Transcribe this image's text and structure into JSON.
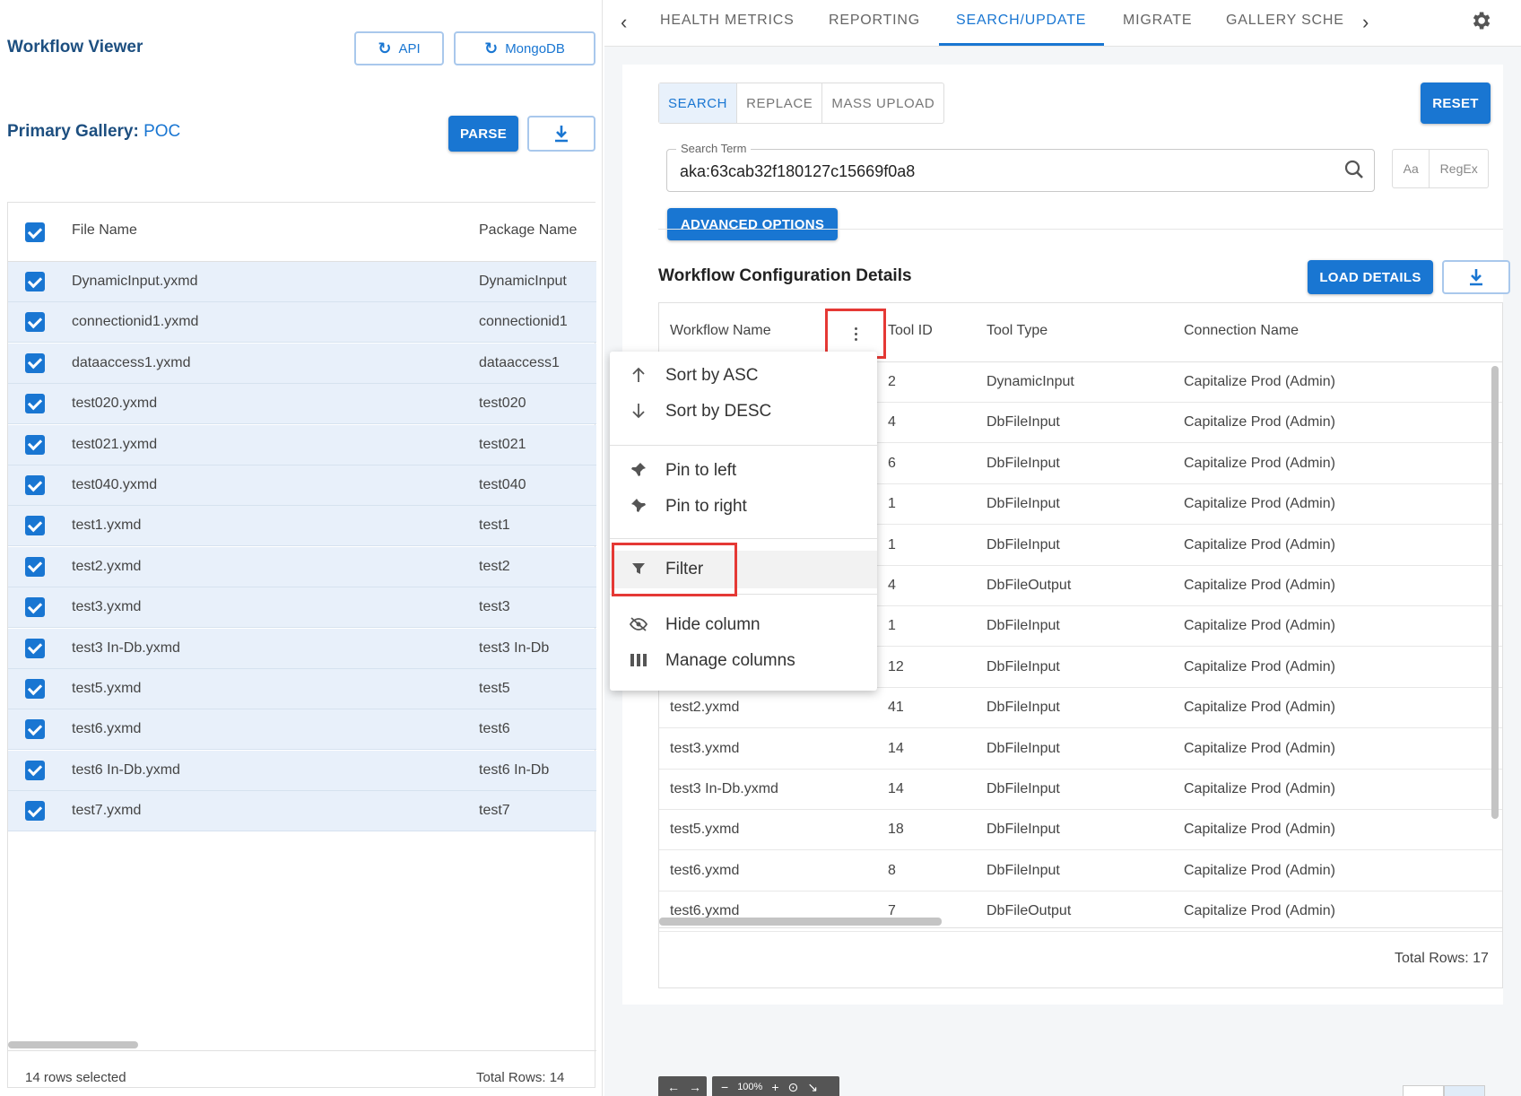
{
  "left": {
    "title": "Workflow Viewer",
    "api_label": "API",
    "mongodb_label": "MongoDB",
    "gallery_label": "Primary Gallery:",
    "gallery_value": "POC",
    "parse_label": "PARSE",
    "headers": {
      "file_name": "File Name",
      "package_name": "Package Name"
    },
    "rows": [
      {
        "file": "DynamicInput.yxmd",
        "pkg": "DynamicInput"
      },
      {
        "file": "connectionid1.yxmd",
        "pkg": "connectionid1"
      },
      {
        "file": "dataaccess1.yxmd",
        "pkg": "dataaccess1"
      },
      {
        "file": "test020.yxmd",
        "pkg": "test020"
      },
      {
        "file": "test021.yxmd",
        "pkg": "test021"
      },
      {
        "file": "test040.yxmd",
        "pkg": "test040"
      },
      {
        "file": "test1.yxmd",
        "pkg": "test1"
      },
      {
        "file": "test2.yxmd",
        "pkg": "test2"
      },
      {
        "file": "test3.yxmd",
        "pkg": "test3"
      },
      {
        "file": "test3 In-Db.yxmd",
        "pkg": "test3 In-Db"
      },
      {
        "file": "test5.yxmd",
        "pkg": "test5"
      },
      {
        "file": "test6.yxmd",
        "pkg": "test6"
      },
      {
        "file": "test6 In-Db.yxmd",
        "pkg": "test6 In-Db"
      },
      {
        "file": "test7.yxmd",
        "pkg": "test7"
      }
    ],
    "rows_selected": "14 rows selected",
    "total_rows": "Total Rows: 14"
  },
  "tabs": {
    "items": [
      "HEALTH METRICS",
      "REPORTING",
      "SEARCH/UPDATE",
      "MIGRATE",
      "GALLERY SCHE"
    ],
    "active": "SEARCH/UPDATE"
  },
  "search": {
    "modes": [
      "SEARCH",
      "REPLACE",
      "MASS UPLOAD"
    ],
    "reset_label": "RESET",
    "term_label": "Search Term",
    "term_value": "aka:63cab32f180127c15669f0a8",
    "case_label": "Aa",
    "regex_label": "RegEx",
    "advanced_label": "ADVANCED OPTIONS"
  },
  "details": {
    "title": "Workflow Configuration Details",
    "load_label": "LOAD DETAILS",
    "headers": {
      "workflow": "Workflow Name",
      "tool_id": "Tool ID",
      "tool_type": "Tool Type",
      "connection": "Connection Name"
    },
    "rows": [
      {
        "wf": "",
        "id": "2",
        "type": "DynamicInput",
        "conn": "Capitalize Prod (Admin)"
      },
      {
        "wf": "",
        "id": "4",
        "type": "DbFileInput",
        "conn": "Capitalize Prod (Admin)"
      },
      {
        "wf": "",
        "id": "6",
        "type": "DbFileInput",
        "conn": "Capitalize Prod (Admin)"
      },
      {
        "wf": "",
        "id": "1",
        "type": "DbFileInput",
        "conn": "Capitalize Prod (Admin)"
      },
      {
        "wf": "",
        "id": "1",
        "type": "DbFileInput",
        "conn": "Capitalize Prod (Admin)"
      },
      {
        "wf": "",
        "id": "4",
        "type": "DbFileOutput",
        "conn": "Capitalize Prod (Admin)"
      },
      {
        "wf": "",
        "id": "1",
        "type": "DbFileInput",
        "conn": "Capitalize Prod (Admin)"
      },
      {
        "wf": "",
        "id": "12",
        "type": "DbFileInput",
        "conn": "Capitalize Prod (Admin)"
      },
      {
        "wf": "test2.yxmd",
        "id": "41",
        "type": "DbFileInput",
        "conn": "Capitalize Prod (Admin)"
      },
      {
        "wf": "test3.yxmd",
        "id": "14",
        "type": "DbFileInput",
        "conn": "Capitalize Prod (Admin)"
      },
      {
        "wf": "test3 In-Db.yxmd",
        "id": "14",
        "type": "DbFileInput",
        "conn": "Capitalize Prod (Admin)"
      },
      {
        "wf": "test5.yxmd",
        "id": "18",
        "type": "DbFileInput",
        "conn": "Capitalize Prod (Admin)"
      },
      {
        "wf": "test6.yxmd",
        "id": "8",
        "type": "DbFileInput",
        "conn": "Capitalize Prod (Admin)"
      },
      {
        "wf": "test6.yxmd",
        "id": "7",
        "type": "DbFileOutput",
        "conn": "Capitalize Prod (Admin)"
      }
    ],
    "total_rows": "Total Rows: 17"
  },
  "column_menu": {
    "items": [
      {
        "label": "Sort by ASC",
        "icon": "arrow-up-icon"
      },
      {
        "label": "Sort by DESC",
        "icon": "arrow-down-icon"
      },
      {
        "label": "Pin to left",
        "icon": "pin-left-icon"
      },
      {
        "label": "Pin to right",
        "icon": "pin-right-icon"
      },
      {
        "label": "Filter",
        "icon": "filter-icon"
      },
      {
        "label": "Hide column",
        "icon": "eye-off-icon"
      },
      {
        "label": "Manage columns",
        "icon": "columns-icon"
      }
    ]
  },
  "viewer": {
    "zoom": "100%"
  },
  "colors": {
    "accent": "#1976d2",
    "highlight": "#e53935",
    "selected_row": "#e8f0fa"
  }
}
